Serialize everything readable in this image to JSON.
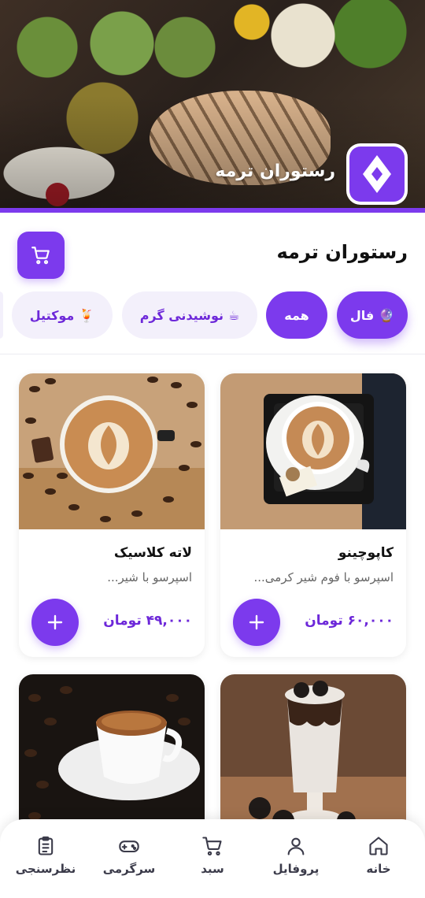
{
  "hero": {
    "restaurant_name": "رستوران ترمه"
  },
  "header": {
    "title": "رستوران ترمه"
  },
  "categories": [
    {
      "label": "فال",
      "icon": "crystal-ball-icon",
      "emoji": "🔮",
      "active": true
    },
    {
      "label": "همه",
      "active": true
    },
    {
      "label": "نوشیدنی گرم",
      "icon": "hot-drink-icon",
      "emoji": "☕",
      "active": false
    },
    {
      "label": "موکتیل",
      "icon": "cocktail-icon",
      "emoji": "🍹",
      "active": false
    }
  ],
  "products": [
    {
      "name": "کاپوچینو",
      "description": "اسپرسو با فوم شیر کرمی...",
      "price": "۶۰,۰۰۰ تومان"
    },
    {
      "name": "لاته کلاسیک",
      "description": "اسپرسو با شیر...",
      "price": "۴۹,۰۰۰ تومان"
    },
    {
      "name": "",
      "description": "",
      "price": ""
    },
    {
      "name": "",
      "description": "",
      "price": ""
    }
  ],
  "bottom_nav": [
    {
      "label": "خانه",
      "icon": "home-icon"
    },
    {
      "label": "پروفایل",
      "icon": "user-icon"
    },
    {
      "label": "سبد",
      "icon": "cart-icon"
    },
    {
      "label": "سرگرمی",
      "icon": "gamepad-icon"
    },
    {
      "label": "نظرسنجی",
      "icon": "clipboard-icon"
    }
  ],
  "colors": {
    "accent": "#7c3aed",
    "accent_dark": "#6d28d9",
    "chip_inactive_bg": "#f3f0fb"
  }
}
